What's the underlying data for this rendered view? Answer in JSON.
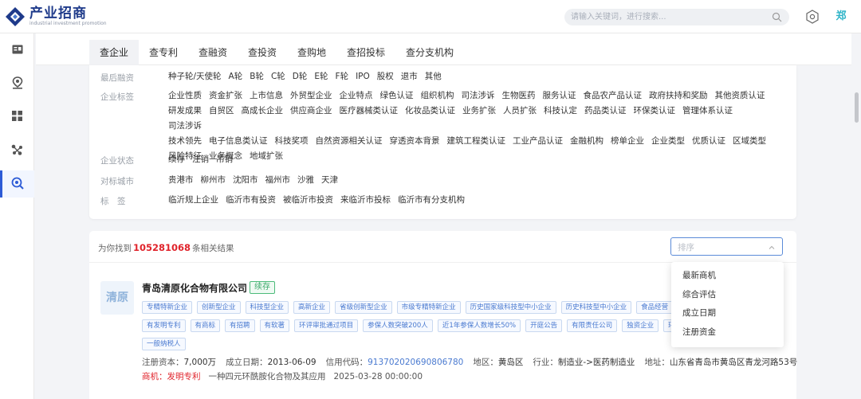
{
  "brand": {
    "title": "产业招商",
    "subtitle": "industrial investment promotion",
    "primary_color": "#1e3a8a",
    "accent_color": "#2d5bd6"
  },
  "header": {
    "search_placeholder": "请输入关键词，进行搜索...",
    "avatar_text": "郑"
  },
  "rail": {
    "items": [
      {
        "icon": "id-card-icon"
      },
      {
        "icon": "map-pin-icon"
      },
      {
        "icon": "grid-icon"
      },
      {
        "icon": "network-icon"
      },
      {
        "icon": "search-circle-icon",
        "active": true
      }
    ]
  },
  "tabs": [
    "查企业",
    "查专利",
    "查融资",
    "查投资",
    "查购地",
    "查招投标",
    "查分支机构"
  ],
  "filters": [
    {
      "label": "最后融资",
      "values": [
        "种子轮/天使轮",
        "A轮",
        "B轮",
        "C轮",
        "D轮",
        "E轮",
        "F轮",
        "IPO",
        "股权",
        "退市",
        "其他"
      ]
    },
    {
      "label": "企业标签",
      "lines": [
        [
          "企业性质",
          "资金扩张",
          "上市信息",
          "外贸型企业",
          "企业特点",
          "绿色认证",
          "组织机构",
          "司法涉诉",
          "生物医药",
          "服务认证",
          "食品农产品认证",
          "政府扶持和奖励",
          "其他资质认证"
        ],
        [
          "研发成果",
          "自贸区",
          "高成长企业",
          "供应商企业",
          "医疗器械类认证",
          "化妆品类认证",
          "业务扩张",
          "人员扩张",
          "科技认定",
          "药品类认证",
          "环保类认证",
          "管理体系认证",
          "司法涉诉"
        ],
        [
          "技术领先",
          "电子信息类认证",
          "科技奖项",
          "自然资源相关认证",
          "穿透资本背景",
          "建筑工程类认证",
          "工业产品认证",
          "金融机构",
          "榜单企业",
          "企业类型",
          "优质认证",
          "区域类型"
        ],
        [
          "风险特征",
          "业务概念",
          "地域扩张"
        ]
      ]
    },
    {
      "label": "企业状态",
      "values": [
        "续存",
        "注销",
        "吊销"
      ]
    },
    {
      "label": "对标城市",
      "values": [
        "贵港市",
        "柳州市",
        "沈阳市",
        "福州市",
        "沙雅",
        "天津"
      ]
    },
    {
      "label": "标　签",
      "values": [
        "临沂规上企业",
        "临沂市有投资",
        "被临沂市投资",
        "来临沂市投标",
        "临沂市有分支机构"
      ]
    }
  ],
  "results": {
    "prefix": "为你找到",
    "count": "105281068",
    "suffix": "条相关结果",
    "sort_placeholder": "排序",
    "sort_options": [
      "最新商机",
      "综合评估",
      "成立日期",
      "注册资金"
    ]
  },
  "company": {
    "logo_text": "清原",
    "name": "青岛清原化合物有限公司",
    "status": "续存",
    "tags_row1": [
      "专精特新企业",
      "创新型企业",
      "科技型企业",
      "高新企业",
      "省级创新型企业",
      "市级专精特新企业",
      "历史国家级科技型中小企业",
      "历史科技型中小企业",
      "食品经营"
    ],
    "tags_row2": [
      "有发明专利",
      "有商标",
      "有招聘",
      "有软著",
      "环评审批通过项目",
      "参保人数突破200人",
      "近1年参保人数增长50%",
      "开庭公告",
      "有限责任公司",
      "独资企业",
      "环"
    ],
    "tags_row3": [
      "一般纳税人"
    ],
    "info": {
      "capital_label": "注册资本：",
      "capital": "7,000万",
      "date_label": "成立日期：",
      "date": "2013-06-09",
      "code_label": "信用代码：",
      "code": "913702020690806780",
      "region_label": "地区：",
      "region": "黄岛区",
      "industry_label": "行业：",
      "industry": "制造业->医药制造业",
      "address_label": "地址：",
      "address": "山东省青岛市黄岛区青龙河路53号"
    },
    "patent": {
      "label": "商机：发明专利",
      "title": "一种四元环酰胺化合物及其应用",
      "time": "2025-03-28 00:00:00"
    }
  }
}
